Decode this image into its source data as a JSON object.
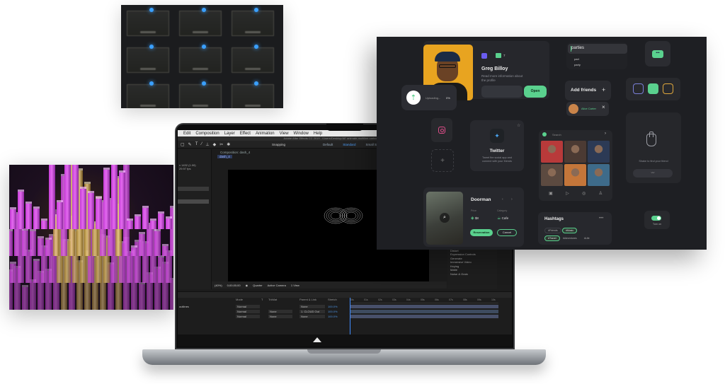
{
  "after_effects": {
    "menu": [
      "Edit",
      "Composition",
      "Layer",
      "Effect",
      "Animation",
      "View",
      "Window",
      "Help"
    ],
    "window_title": "Adobe After Effects CC 2019 - /Users/Desktop/AE animate-multiline-carbon/Multiline Patterns.aep",
    "toolbar_snapping": "Snapping",
    "workspaces": [
      "Default",
      "Standard",
      "Small Sc"
    ],
    "project_meta": [
      "x 1432 (1.00)",
      "29.97 fps"
    ],
    "composition_tab": "Composition: dash_4",
    "comp_name_tab": "dash_4",
    "viewer_controls": {
      "zoom": "(40%)",
      "timecode": "0;00;00;00",
      "resolution": "Quarter",
      "camera": "Active Camera",
      "views": "1 View"
    },
    "effects_list": [
      "Color Correction",
      "Distort",
      "Expression Controls",
      "Generate",
      "Immersive Video",
      "Keying",
      "Matte",
      "Noise & Grain"
    ],
    "timeline_columns": [
      "Mode",
      "T",
      "TrkMat",
      "Parent & Link",
      "Stretch"
    ],
    "timeline_rows": [
      {
        "name": "outlines",
        "mode": "Normal",
        "track": "",
        "parent": "None",
        "stretch": "100.0%"
      },
      {
        "name": "",
        "mode": "Normal",
        "track": "None",
        "parent": "1. CLOUD Out",
        "stretch": "100.0%"
      },
      {
        "name": "",
        "mode": "Normal",
        "track": "None",
        "parent": "None",
        "stretch": "100.0%"
      }
    ],
    "ruler_ticks": [
      "00s",
      "01s",
      "02s",
      "03s",
      "04s",
      "05s",
      "06s",
      "07s",
      "08s",
      "09s",
      "10s"
    ]
  },
  "widgets": {
    "profile": {
      "name": "Greg Billoy",
      "description": "Read more information about the profile",
      "badge_count": "7",
      "open_label": "Open"
    },
    "upload": {
      "text": "Uploading...",
      "percent": "0%"
    },
    "search": {
      "value": "parties",
      "options": [
        "part",
        "party"
      ]
    },
    "chat_icon_text": "•••",
    "add_friends": {
      "label": "Add friends",
      "plus": "+",
      "friend_name": "Alice Carter",
      "remove": "×"
    },
    "twitter": {
      "title": "Twitter",
      "description": "Tweet fire social app and connect with your friends",
      "star": "☆"
    },
    "photos": {
      "search_placeholder": "Search",
      "arrow": "›"
    },
    "doorman": {
      "title": "Doorman",
      "nav": "‹ ›",
      "price_label": "Price",
      "price": "$8",
      "category_label": "Category",
      "category": "Cafe",
      "reserve_label": "Reservation",
      "cancel_label": "Cancel"
    },
    "hashtags": {
      "title": "Hashtags",
      "more": "•••",
      "tags": [
        "#Friends",
        "#Music",
        "#Travel",
        "#Adventures",
        "#Life"
      ]
    },
    "hand": {
      "text": "Shake to find your friend",
      "button": "〰"
    },
    "toggle": {
      "label": "Turn on"
    }
  },
  "colors": {
    "accent_green": "#5ad18e",
    "board_bg": "#1e1f23",
    "twitter_blue": "#4aa5f2",
    "instagram_pink": "#e14d8a"
  }
}
